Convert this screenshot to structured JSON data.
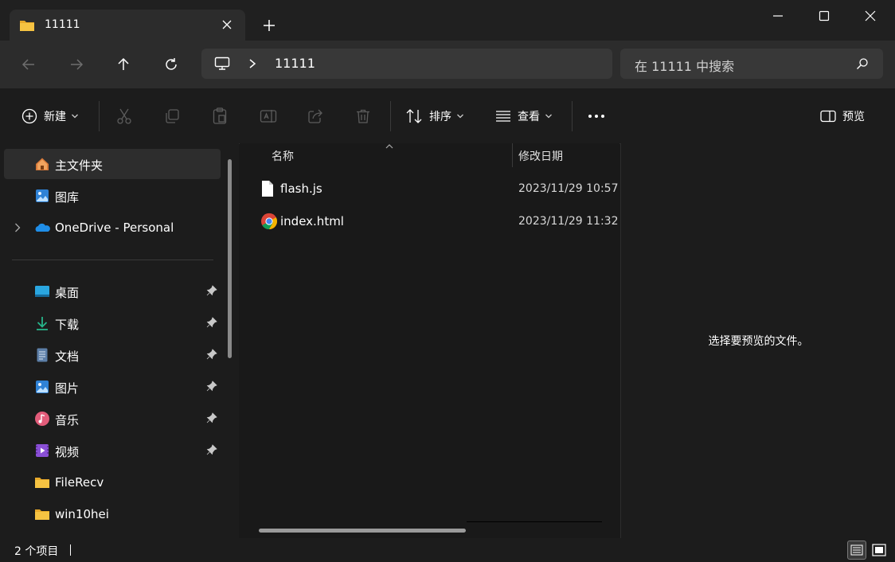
{
  "window": {
    "tab_title": "11111",
    "controls": [
      "minimize",
      "maximize",
      "close"
    ]
  },
  "nav": {
    "address_path": [
      "This PC",
      "11111"
    ],
    "address_current": "11111",
    "search_placeholder": "在 11111 中搜索"
  },
  "toolbar": {
    "new_label": "新建",
    "sort_label": "排序",
    "view_label": "查看",
    "preview_label": "预览",
    "actions": [
      "cut",
      "copy",
      "paste",
      "rename",
      "share",
      "delete"
    ]
  },
  "sidebar": {
    "items": [
      {
        "label": "主文件夹",
        "icon": "home-icon",
        "selected": true
      },
      {
        "label": "图库",
        "icon": "gallery-icon"
      },
      {
        "label": "OneDrive - Personal",
        "icon": "onedrive-icon",
        "expandable": true
      },
      {
        "label": "桌面",
        "icon": "desktop-icon",
        "pinned": true
      },
      {
        "label": "下载",
        "icon": "download-icon",
        "pinned": true
      },
      {
        "label": "文档",
        "icon": "document-icon",
        "pinned": true
      },
      {
        "label": "图片",
        "icon": "pictures-icon",
        "pinned": true
      },
      {
        "label": "音乐",
        "icon": "music-icon",
        "pinned": true
      },
      {
        "label": "视频",
        "icon": "video-icon",
        "pinned": true
      },
      {
        "label": "FileRecv",
        "icon": "folder-icon"
      },
      {
        "label": "win10hei",
        "icon": "folder-icon"
      }
    ]
  },
  "filelist": {
    "columns": [
      "名称",
      "修改日期"
    ],
    "files": [
      {
        "name": "flash.js",
        "modified": "2023/11/29 10:57",
        "icon": "file-icon"
      },
      {
        "name": "index.html",
        "modified": "2023/11/29 11:32",
        "icon": "chrome-icon"
      }
    ]
  },
  "preview": {
    "message": "选择要预览的文件。"
  },
  "status": {
    "count_text": "2 个项目"
  },
  "colors": {
    "background": "#191919",
    "chrome": "#2c2c2c",
    "folder_yellow": "#f6c342",
    "accent_blue": "#3a8ee6"
  }
}
